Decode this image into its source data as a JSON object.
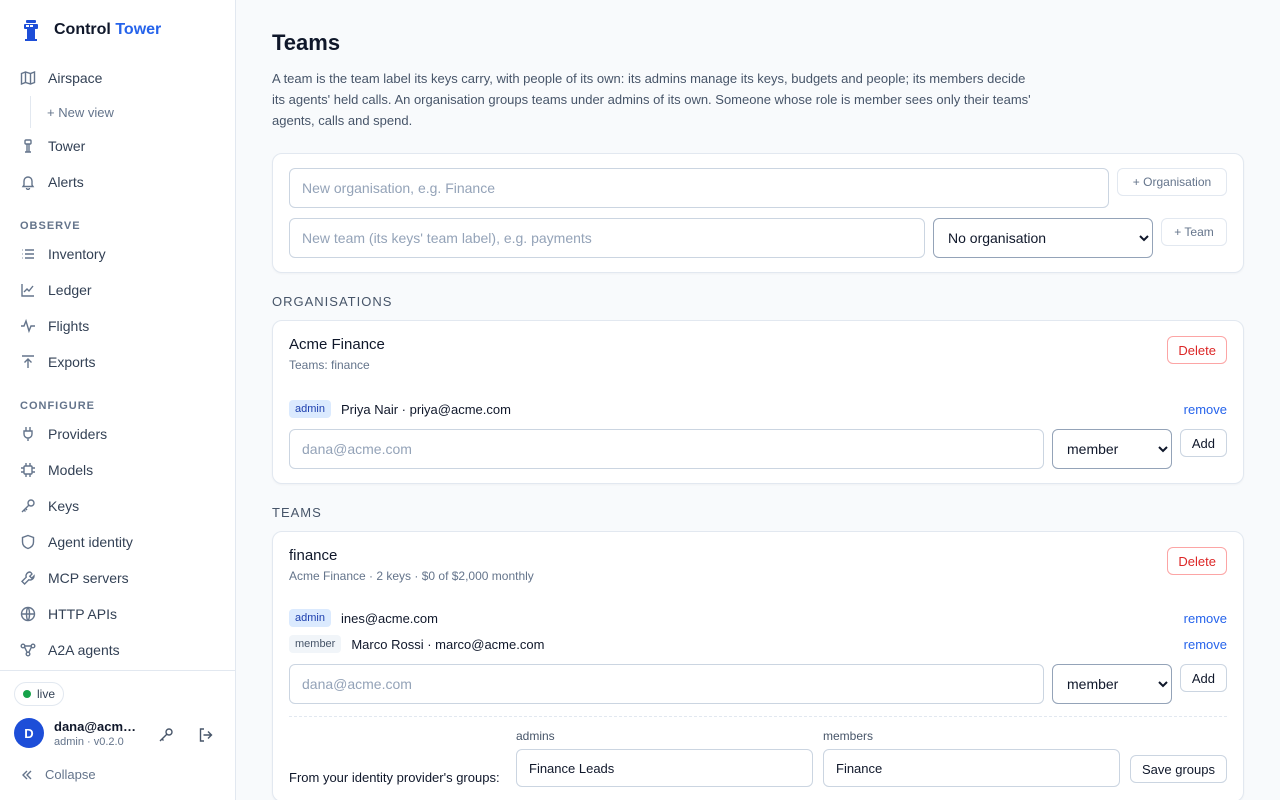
{
  "brand": {
    "name": "Control",
    "accent": "Tower",
    "accent_color": "#2563eb"
  },
  "nav": {
    "top": [
      {
        "label": "Airspace",
        "icon": "map-icon"
      },
      {
        "label": "+ New view",
        "icon": ""
      },
      {
        "label": "Tower",
        "icon": "tower-icon"
      },
      {
        "label": "Alerts",
        "icon": "bell-icon"
      }
    ],
    "observe_title": "OBSERVE",
    "observe": [
      {
        "label": "Inventory",
        "icon": "list-icon"
      },
      {
        "label": "Ledger",
        "icon": "chart-line-icon"
      },
      {
        "label": "Flights",
        "icon": "activity-icon"
      },
      {
        "label": "Exports",
        "icon": "upload-icon"
      }
    ],
    "configure_title": "CONFIGURE",
    "configure": [
      {
        "label": "Providers",
        "icon": "plug-icon"
      },
      {
        "label": "Models",
        "icon": "cpu-icon"
      },
      {
        "label": "Keys",
        "icon": "key-icon"
      },
      {
        "label": "Agent identity",
        "icon": "shield-icon"
      },
      {
        "label": "MCP servers",
        "icon": "wrench-icon"
      },
      {
        "label": "HTTP APIs",
        "icon": "globe-icon"
      },
      {
        "label": "A2A agents",
        "icon": "network-icon"
      }
    ]
  },
  "footer": {
    "status": "live",
    "avatar_initial": "D",
    "user_name": "dana@acme.com",
    "user_meta": "admin · v0.2.0",
    "collapse_label": "Collapse"
  },
  "page": {
    "title": "Teams",
    "description": "A team is the team label its keys carry, with people of its own: its admins manage its keys, budgets and people; its members decide its agents' held calls. An organisation groups teams under admins of its own. Someone whose role is member sees only their teams' agents, calls and spend."
  },
  "create": {
    "org_placeholder": "New organisation, e.g. Finance",
    "org_button": "+ Organisation",
    "team_placeholder": "New team (its keys' team label), e.g. payments",
    "org_select": "No organisation",
    "team_button": "+ Team"
  },
  "organisations": {
    "section_label": "ORGANISATIONS",
    "items": [
      {
        "name": "Acme Finance",
        "sub": "Teams: finance",
        "delete_label": "Delete",
        "members": [
          {
            "role": "admin",
            "label": "Priya Nair · priya@acme.com",
            "remove": "remove"
          }
        ],
        "add_placeholder": "dana@acme.com",
        "add_role": "member",
        "add_button": "Add"
      }
    ]
  },
  "teams": {
    "section_label": "TEAMS",
    "items": [
      {
        "name": "finance",
        "sub": "Acme Finance · 2 keys · $0 of $2,000 monthly",
        "delete_label": "Delete",
        "members": [
          {
            "role": "admin",
            "label": "ines@acme.com",
            "remove": "remove"
          },
          {
            "role": "member",
            "label": "Marco Rossi · marco@acme.com",
            "remove": "remove"
          }
        ],
        "add_placeholder": "dana@acme.com",
        "add_role": "member",
        "add_button": "Add",
        "idp": {
          "label": "From your identity provider's groups:",
          "admins_label": "admins",
          "admins_value": "Finance Leads",
          "members_label": "members",
          "members_value": "Finance",
          "save_button": "Save groups"
        }
      }
    ]
  }
}
